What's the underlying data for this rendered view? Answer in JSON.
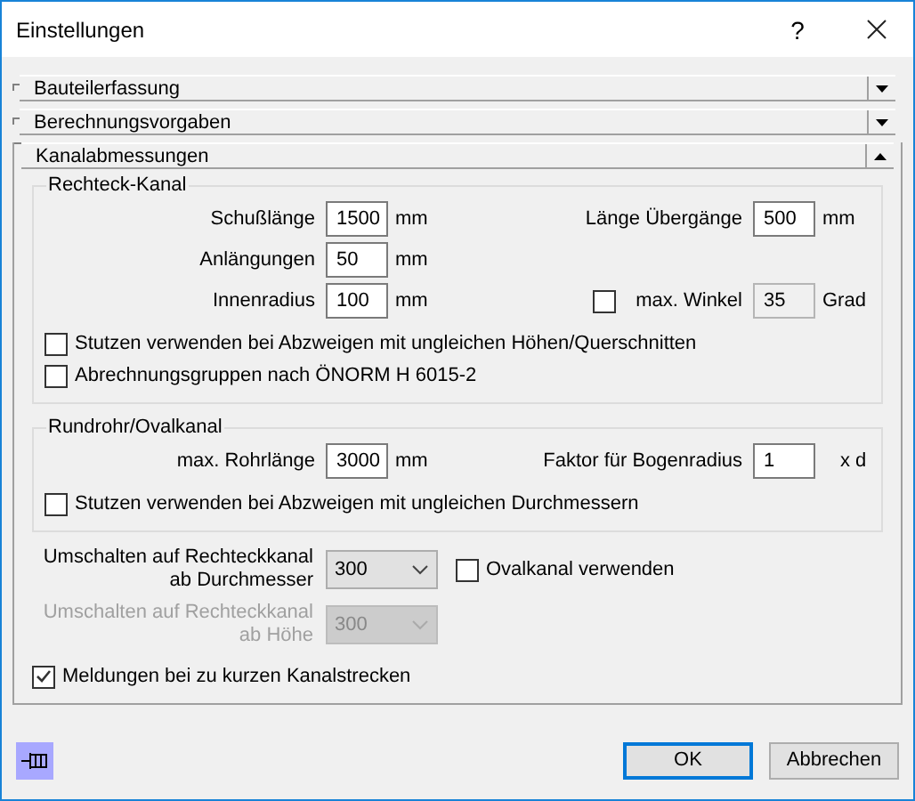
{
  "window": {
    "title": "Einstellungen",
    "help": "?"
  },
  "sections": [
    {
      "title": "Bauteilerfassung",
      "expanded": false
    },
    {
      "title": "Berechnungsvorgaben",
      "expanded": false
    },
    {
      "title": "Kanalabmessungen",
      "expanded": true,
      "content": {
        "rechteck_kanal": {
          "title": "Rechteck-Kanal",
          "rows": [
            {
              "left": {
                "label": "Schußlänge",
                "value": "1500",
                "unit": "mm"
              },
              "right": {
                "label": "Länge Übergänge",
                "value": "500",
                "unit": "mm",
                "disabled": false
              }
            },
            {
              "left": {
                "label": "Anlängungen",
                "value": "50",
                "unit": "mm"
              }
            },
            {
              "left": {
                "label": "Innenradius",
                "value": "100",
                "unit": "mm"
              },
              "right": {
                "label": "max. Winkel",
                "value": "35",
                "unit": "Grad",
                "disabled": true,
                "toggle": {
                  "checked": false
                }
              }
            }
          ],
          "checkboxes": [
            {
              "label": "Stutzen verwenden bei Abzweigen mit ungleichen Höhen/Querschnitten",
              "checked": false
            },
            {
              "label": "Abrechnungsgruppen nach ÖNORM H 6015-2",
              "checked": false
            }
          ]
        },
        "rundrohr": {
          "title": "Rundrohr/Ovalkanal",
          "rows": [
            {
              "left": {
                "label": "max. Rohrlänge",
                "value": "3000",
                "unit": "mm"
              },
              "right": {
                "label": "Faktor für Bogenradius",
                "value": "1",
                "unit": "x d",
                "disabled": false
              }
            }
          ],
          "checkboxes": [
            {
              "label": "Stutzen verwenden bei Abzweigen mit ungleichen Durchmessern",
              "checked": false
            }
          ]
        },
        "dropdowns": [
          {
            "label": [
              "Umschalten auf Rechteckkanal",
              "ab Durchmesser"
            ],
            "value": "300",
            "disabled": false,
            "checkbox": {
              "label": "Ovalkanal verwenden",
              "checked": false
            }
          },
          {
            "label": [
              "Umschalten auf Rechteckkanal",
              "ab Höhe"
            ],
            "value": "300",
            "disabled": true
          }
        ],
        "checkboxes": [
          {
            "label": "Meldungen bei zu kurzen Kanalstrecken",
            "checked": true
          }
        ]
      }
    }
  ],
  "buttons": [
    {
      "label": "OK",
      "default": true
    },
    {
      "label": "Abbrechen",
      "default": false
    }
  ]
}
